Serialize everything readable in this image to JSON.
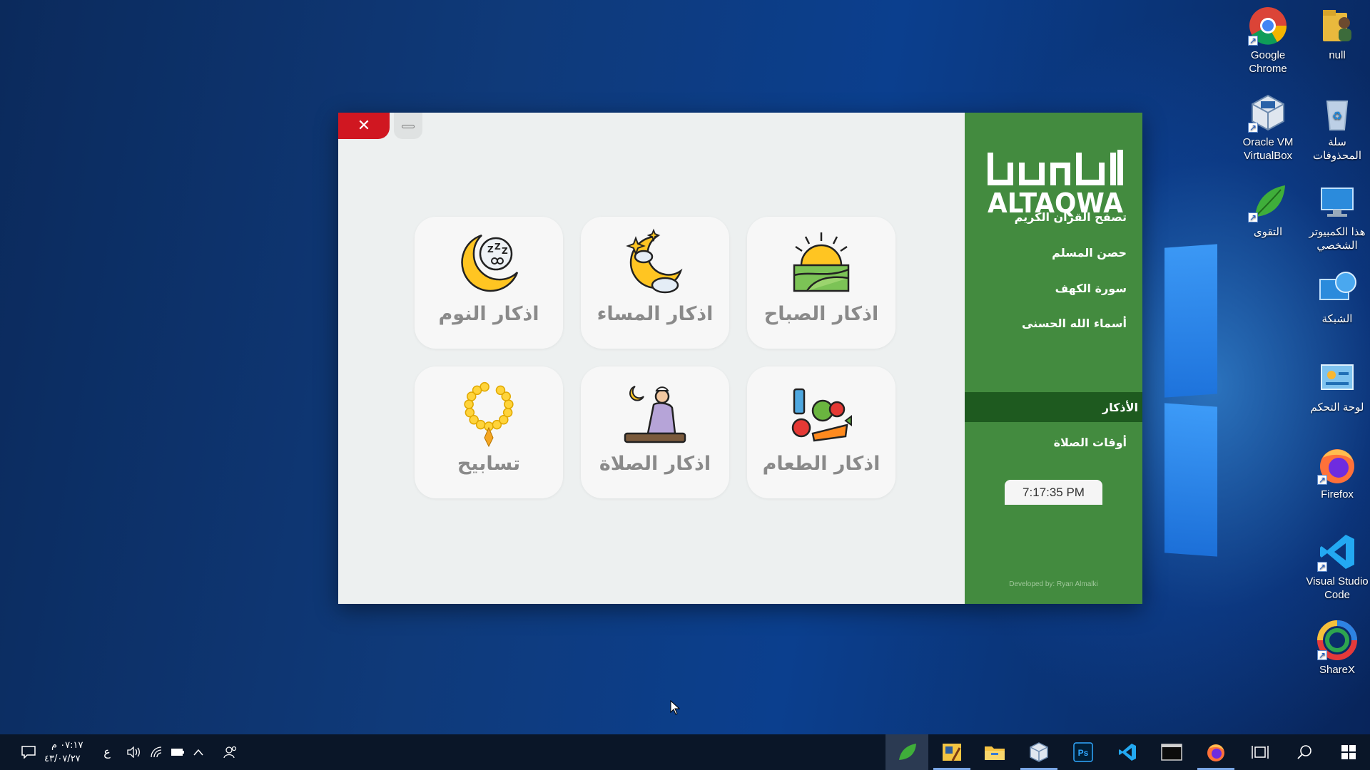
{
  "desktop": {
    "icons": [
      {
        "label": "Google\nChrome",
        "icon": "chrome-icon"
      },
      {
        "label": "null",
        "icon": "user-folder-icon"
      },
      {
        "label": "Oracle VM\nVirtualBox",
        "icon": "virtualbox-icon"
      },
      {
        "label": "سلة\nالمحذوفات",
        "icon": "recycle-bin-icon"
      },
      {
        "label": "التقوى",
        "icon": "leaf-app-icon"
      },
      {
        "label": "هذا الكمبيوتر\nالشخصي",
        "icon": "this-pc-icon"
      },
      {
        "label": "الشبكة",
        "icon": "network-icon"
      },
      {
        "label": "لوحة التحكم",
        "icon": "control-panel-icon"
      },
      {
        "label": "Firefox",
        "icon": "firefox-icon"
      },
      {
        "label": "Visual Studio\nCode",
        "icon": "vscode-icon"
      },
      {
        "label": "ShareX",
        "icon": "sharex-icon"
      }
    ]
  },
  "app": {
    "close_label": "✕",
    "tiles": [
      {
        "label": "اذكار الصباح",
        "icon": "sunrise-icon"
      },
      {
        "label": "اذكار المساء",
        "icon": "moon-cloud-icon"
      },
      {
        "label": "اذكار النوم",
        "icon": "sleep-moon-icon"
      },
      {
        "label": "اذكار الطعام",
        "icon": "food-icon"
      },
      {
        "label": "اذكار الصلاة",
        "icon": "prayer-icon"
      },
      {
        "label": "تسابيح",
        "icon": "prayer-beads-icon"
      }
    ],
    "sidebar": {
      "logo_text": "ALTAQWA",
      "items": [
        {
          "label": "تصفح القرآن الكريم"
        },
        {
          "label": "حصن المسلم"
        },
        {
          "label": "سورة الكهف"
        },
        {
          "label": "أسماء الله الحسنى"
        },
        {
          "label": "الأذكار"
        },
        {
          "label": "أوقات الصلاة"
        }
      ],
      "active_item": "الأذكار",
      "clock": "7:17:35 PM",
      "developer": "Developed by: Ryan Almalki"
    }
  },
  "taskbar": {
    "time": "٠٧:١٧ م",
    "date": "٤٣/٠٧/٢٧",
    "lang": "ع",
    "apps": [
      "start-icon",
      "search-icon",
      "task-view-icon",
      "firefox-icon",
      "terminal-icon",
      "vscode-icon",
      "photoshop-icon",
      "virtualbox-icon",
      "file-explorer-icon",
      "paint-icon",
      "altaqwa-icon"
    ]
  },
  "colors": {
    "sidebar": "#438b3f",
    "sidebar_active": "#1e5a1f",
    "close": "#d01721",
    "tile_text": "#8a8a8a"
  }
}
